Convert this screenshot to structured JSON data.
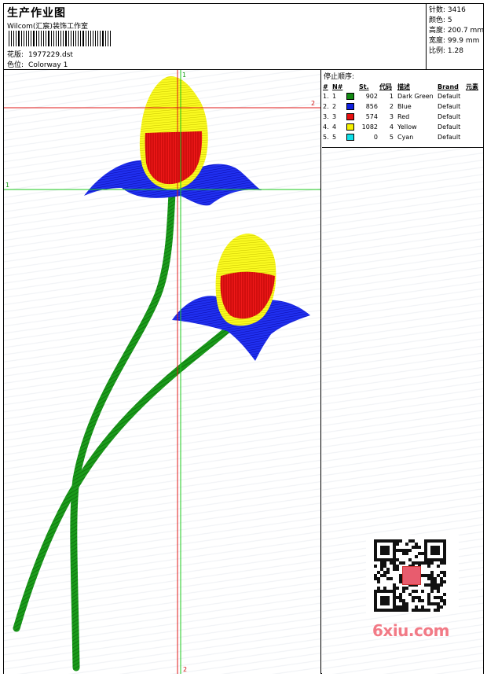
{
  "header": {
    "title": "生产作业图",
    "company": "Wilcom(汇宸)装饰工作室",
    "design_label": "花版:",
    "design_file": "1977229.dst",
    "colorway_label": "色位:",
    "colorway": "Colorway 1"
  },
  "stats": [
    {
      "label": "针数:",
      "value": "3416"
    },
    {
      "label": "颜色:",
      "value": "5"
    },
    {
      "label": "高度:",
      "value": "200.7 mm"
    },
    {
      "label": "宽度:",
      "value": "99.9 mm"
    },
    {
      "label": "比例:",
      "value": "1.28"
    }
  ],
  "guides": {
    "green_v_top": "1",
    "red_h": "2",
    "green_h": "1",
    "red_v_bottom": "2"
  },
  "stop_sequence": {
    "title": "停止顺序:",
    "columns": [
      "#",
      "N#",
      "",
      "St.",
      "代码",
      "描述",
      "Brand",
      "元素"
    ],
    "rows": [
      {
        "idx": "1.",
        "n": "1",
        "color": "#138a13",
        "stitches": "902",
        "code": "1",
        "desc": "Dark Green",
        "brand": "Default",
        "elem": ""
      },
      {
        "idx": "2.",
        "n": "2",
        "color": "#1020e0",
        "stitches": "856",
        "code": "2",
        "desc": "Blue",
        "brand": "Default",
        "elem": ""
      },
      {
        "idx": "3.",
        "n": "3",
        "color": "#e81010",
        "stitches": "574",
        "code": "3",
        "desc": "Red",
        "brand": "Default",
        "elem": ""
      },
      {
        "idx": "4.",
        "n": "4",
        "color": "#f5f000",
        "stitches": "1082",
        "code": "4",
        "desc": "Yellow",
        "brand": "Default",
        "elem": ""
      },
      {
        "idx": "5.",
        "n": "5",
        "color": "#10e0e8",
        "stitches": "0",
        "code": "5",
        "desc": "Cyan",
        "brand": "Default",
        "elem": ""
      }
    ]
  },
  "watermark": "6xiu.com",
  "qr_seal_text": "汇宸"
}
